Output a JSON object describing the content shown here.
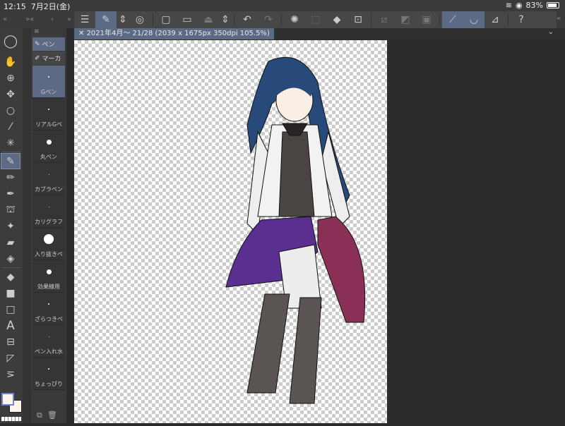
{
  "status": {
    "time": "12:15",
    "date": "7月2日(金)",
    "battery": "83%",
    "battery_level": 0.83
  },
  "toolbar": {
    "icons": [
      "menu-icon",
      "subtool-icon",
      "updown-icon",
      "target-icon",
      "new-icon",
      "open-icon",
      "save-icon",
      "updown-icon",
      "undo-icon",
      "redo-icon",
      "deselect-icon",
      "select-icon",
      "fill-icon",
      "transform-icon",
      "clear-icon",
      "clear-outside-icon",
      "crop-icon",
      "ruler-snap-icon",
      "special-ruler-snap-icon",
      "grid-snap-icon",
      "help-icon"
    ]
  },
  "tab": {
    "title": "2021年4月～ 21/28 (2039 x 1675px 350dpi 105.5%)"
  },
  "subtool": {
    "categories": [
      {
        "label": "ペン"
      },
      {
        "label": "マーカ"
      }
    ],
    "brushes": [
      {
        "label": "Gペン"
      },
      {
        "label": "リアルGペ"
      },
      {
        "label": "丸ペン"
      },
      {
        "label": "カブラペン"
      },
      {
        "label": "カリグラフ"
      },
      {
        "label": "入り抜きペ"
      },
      {
        "label": "効果線用"
      },
      {
        "label": "ざらつきペ"
      },
      {
        "label": "ペン入れ水"
      },
      {
        "label": "ちょっぴり"
      }
    ]
  },
  "colors": {
    "main": "#fff5ea",
    "sub": "#fff5ea",
    "accent": "#5d6a86"
  }
}
